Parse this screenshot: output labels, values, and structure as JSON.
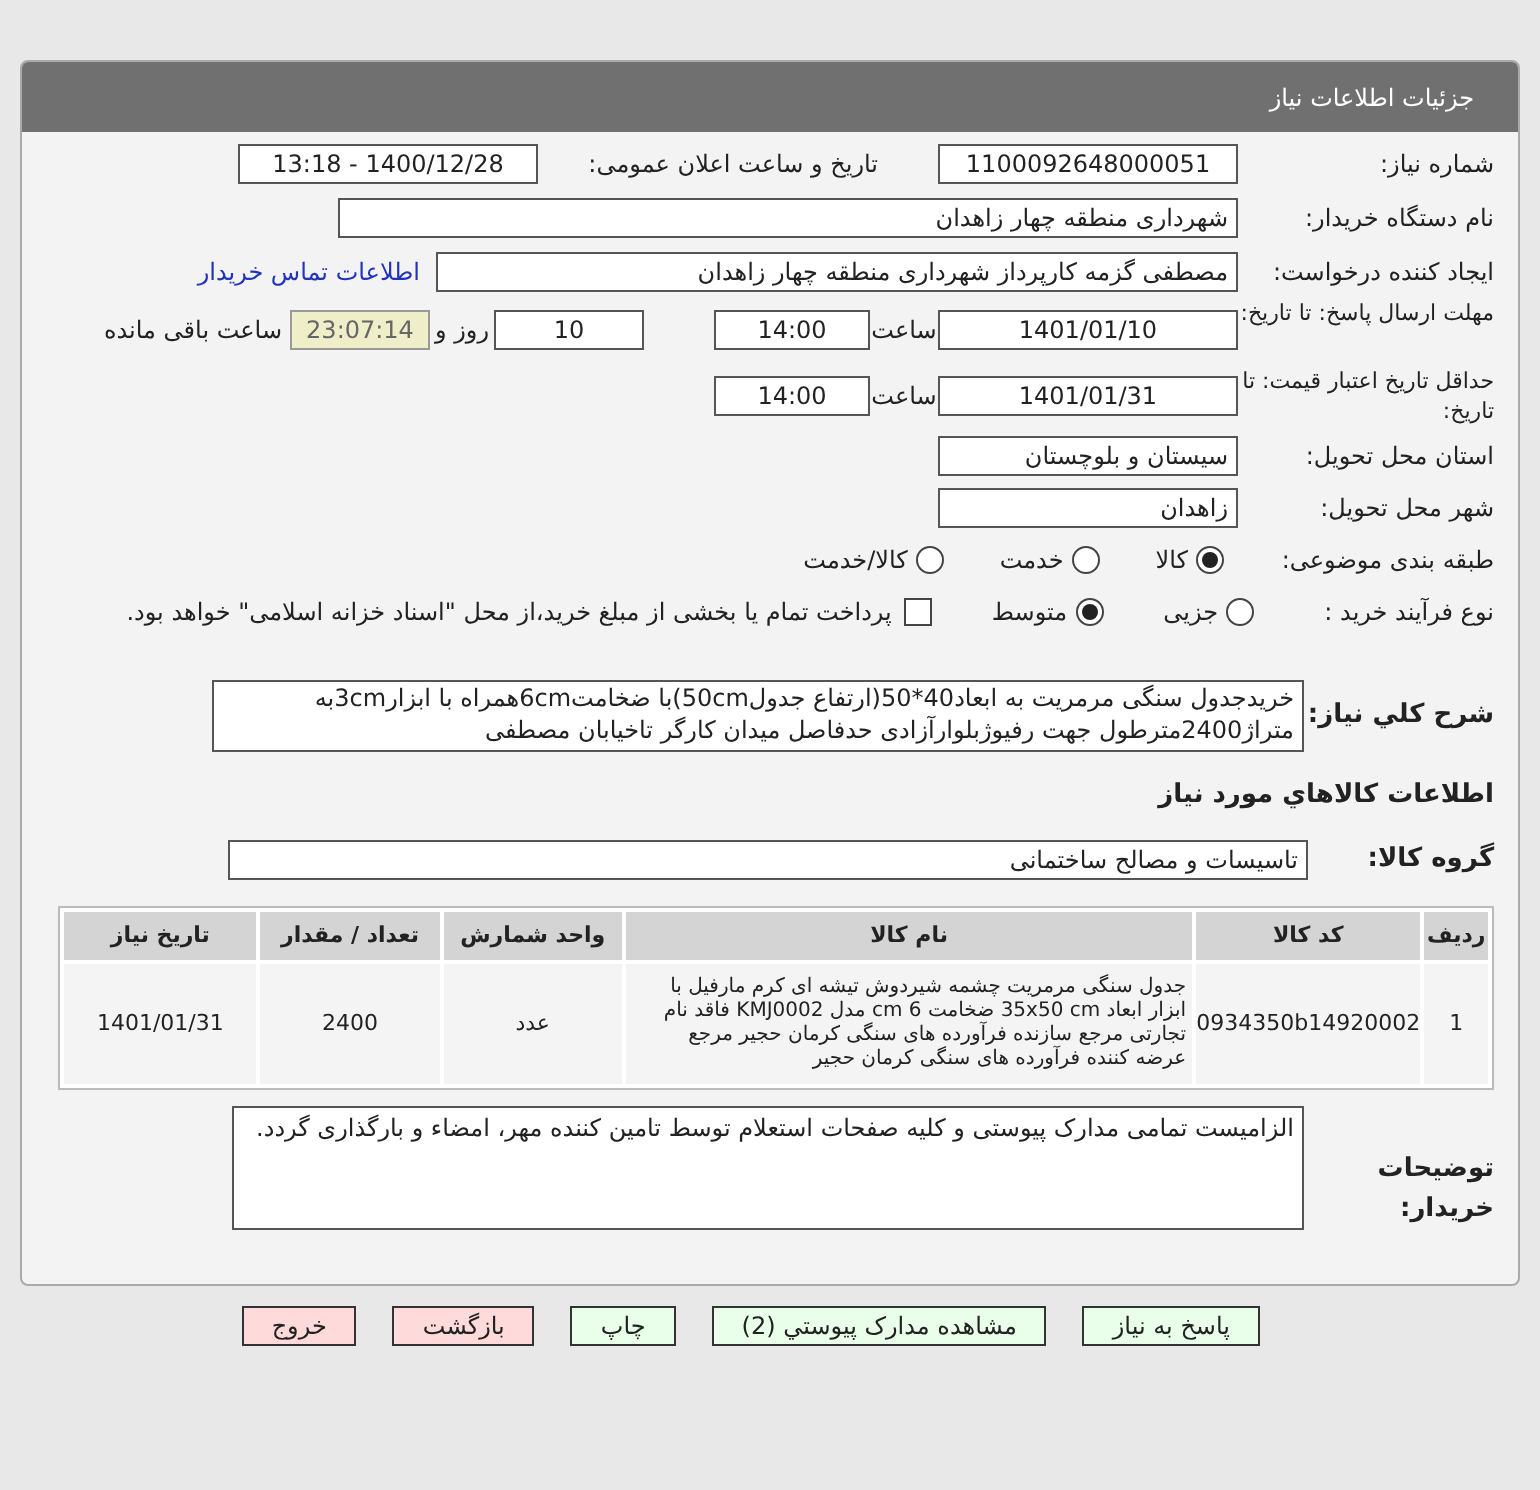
{
  "panel": {
    "title": "جزئیات اطلاعات نیاز"
  },
  "need_number": {
    "label": "شماره نیاز:",
    "value": "1100092648000051"
  },
  "announce": {
    "label": "تاریخ و ساعت اعلان عمومی:",
    "value": "1400/12/28 - 13:18"
  },
  "buyer_org": {
    "label": "نام دستگاه خریدار:",
    "value": "شهرداری منطقه چهار زاهدان"
  },
  "requester": {
    "label": "ایجاد کننده درخواست:",
    "value": "مصطفی گزمه کارپرداز شهرداری منطقه چهار زاهدان",
    "link": "اطلاعات تماس خریدار"
  },
  "response_deadline": {
    "label": "مهلت ارسال پاسخ: تا تاریخ:",
    "date": "1401/01/10",
    "time_label": "ساعت",
    "time": "14:00",
    "days": "10",
    "days_label": "روز و",
    "remaining": "23:07:14",
    "remaining_label": "ساعت باقی مانده"
  },
  "price_validity": {
    "label": "حداقل تاریخ اعتبار قیمت: تا تاریخ:",
    "date": "1401/01/31",
    "time_label": "ساعت",
    "time": "14:00"
  },
  "province": {
    "label": "استان محل تحویل:",
    "value": "سیستان و بلوچستان"
  },
  "city": {
    "label": "شهر محل تحویل:",
    "value": "زاهدان"
  },
  "category": {
    "label": "طبقه بندی موضوعی:",
    "options": [
      {
        "label": "کالا",
        "selected": true
      },
      {
        "label": "خدمت",
        "selected": false
      },
      {
        "label": "کالا/خدمت",
        "selected": false
      }
    ]
  },
  "process": {
    "label": "نوع فرآیند خرید :",
    "options": [
      {
        "label": "جزیی",
        "selected": false
      },
      {
        "label": "متوسط",
        "selected": true
      }
    ],
    "payment_checkbox": {
      "checked": false,
      "text": "پرداخت تمام یا بخشی از مبلغ خرید،از محل \"اسناد خزانه اسلامی\" خواهد بود."
    }
  },
  "description": {
    "label": "شرح کلي نياز:",
    "value": "خریدجدول سنگی مرمریت به ابعاد40*50(ارتفاع جدول50cm)با ضخامت6cmهمراه با ابزار3cmبه متراژ2400مترطول جهت رفیوژبلوارآزادی حدفاصل میدان کارگر تاخیابان مصطفی"
  },
  "goods_heading": "اطلاعات كالاهاي مورد نياز",
  "goods_group": {
    "label": "گروه کالا:",
    "value": "تاسیسات و مصالح ساختمانی"
  },
  "table": {
    "columns": [
      "ردیف",
      "کد کالا",
      "نام کالا",
      "واحد شمارش",
      "تعداد / مقدار",
      "تاریخ نیاز"
    ],
    "rows": [
      [
        "1",
        "0934350b14920002",
        "جدول سنگی مرمریت چشمه شیردوش تیشه ای کرم مارفیل با ابزار ابعاد 35x50 cm ضخامت 6 cm مدل KMJ0002 فاقد نام تجارتی مرجع سازنده فرآورده های سنگی کرمان حجیر مرجع عرضه کننده فرآورده های سنگی کرمان حجیر",
        "عدد",
        "2400",
        "1401/01/31"
      ]
    ]
  },
  "buyer_notes": {
    "label": "توضیحات خریدار:",
    "value": "الزامیست تمامی مدارک پیوستی و کلیه صفحات استعلام توسط تامین کننده مهر، امضاء و بارگذاری گردد."
  },
  "buttons": [
    {
      "label": "پاسخ به نیاز",
      "kind": "normal"
    },
    {
      "label": "مشاهده مدارک پیوستي (2)",
      "kind": "normal"
    },
    {
      "label": "چاپ",
      "kind": "normal"
    },
    {
      "label": "بازگشت",
      "kind": "exit"
    },
    {
      "label": "خروج",
      "kind": "exit"
    }
  ]
}
